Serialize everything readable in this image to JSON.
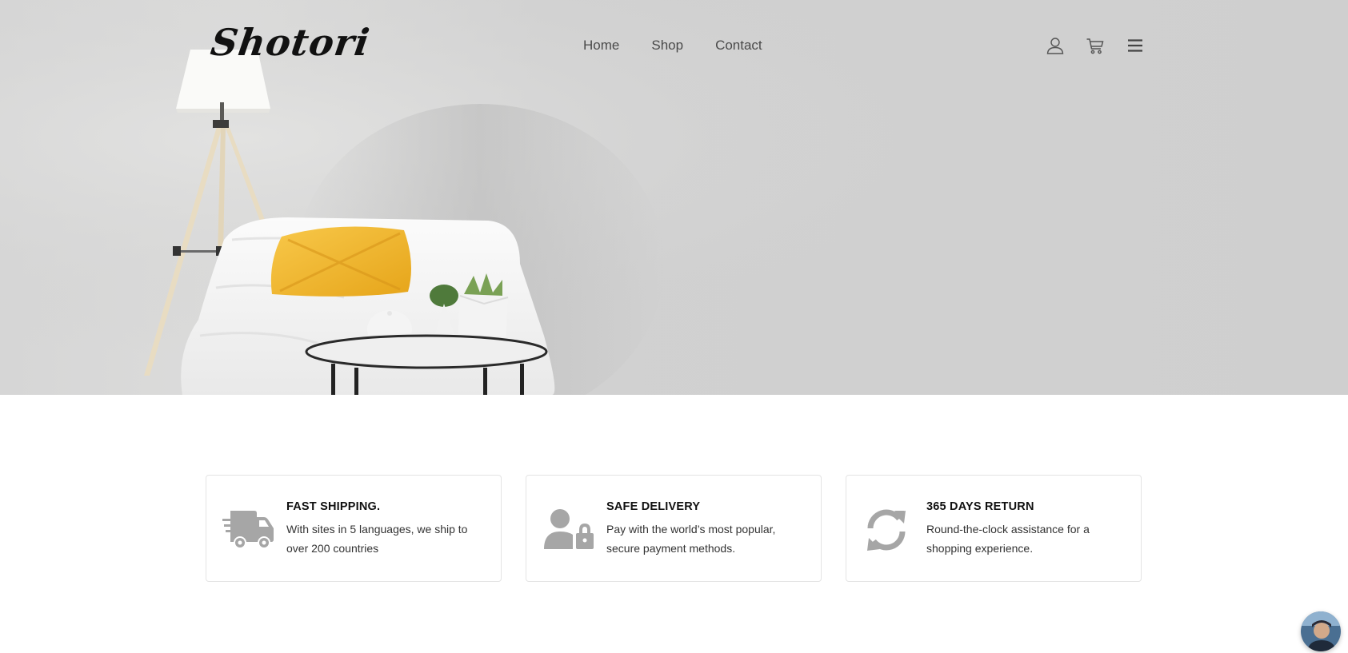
{
  "brand": {
    "logo_text": "Shotori"
  },
  "nav": {
    "items": [
      {
        "label": "Home"
      },
      {
        "label": "Shop"
      },
      {
        "label": "Contact"
      }
    ]
  },
  "header_icons": [
    "user-icon",
    "cart-icon",
    "menu-icon"
  ],
  "colors": {
    "hero_background": "#cfcfcf",
    "pillow_accent": "#f2b72a",
    "icon_gray": "#a6a6a6",
    "card_border": "#e4e4e4"
  },
  "features": [
    {
      "icon": "truck-icon",
      "title": "FAST SHIPPING.",
      "description": "With sites in 5 languages, we ship to over 200 countries"
    },
    {
      "icon": "user-lock-icon",
      "title": "SAFE DELIVERY",
      "description": "Pay with the world’s most popular, secure payment methods."
    },
    {
      "icon": "refresh-icon",
      "title": "365 DAYS RETURN",
      "description": "Round-the-clock assistance for a shopping experience."
    }
  ],
  "chat": {
    "icon": "chat-avatar"
  }
}
